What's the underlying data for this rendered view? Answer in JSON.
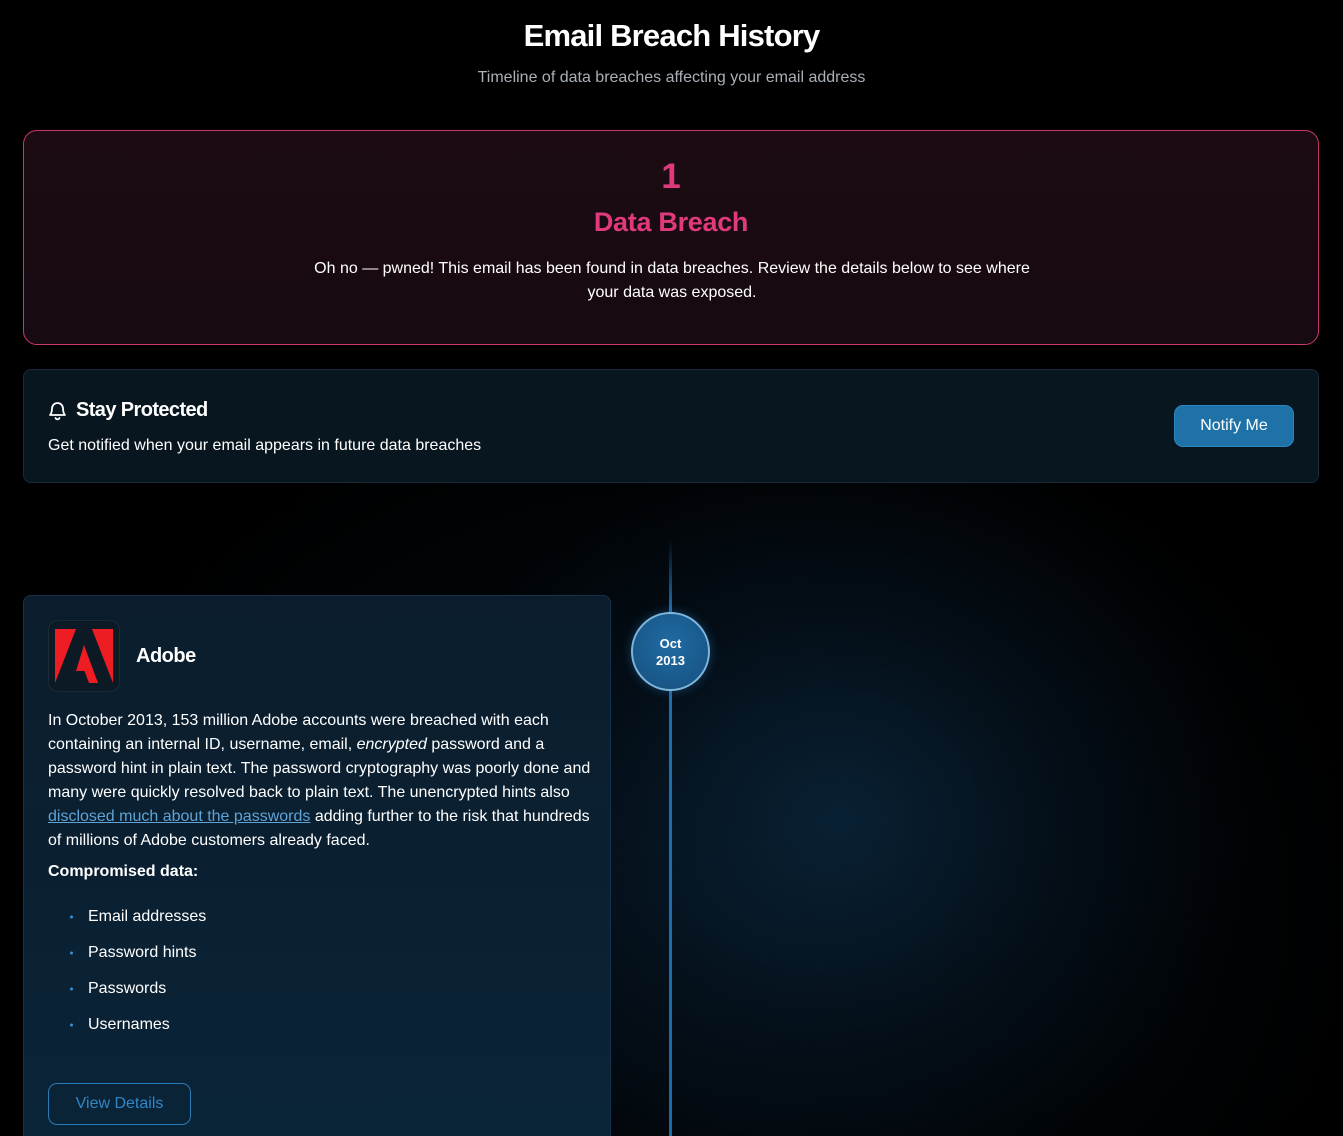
{
  "header": {
    "title": "Email Breach History",
    "subtitle": "Timeline of data breaches affecting your email address"
  },
  "summary": {
    "count": "1",
    "label": "Data Breach",
    "message": "Oh no — pwned! This email has been found in data breaches. Review the details below to see where your data was exposed.",
    "accent_color": "#e03a7c"
  },
  "notify": {
    "icon": "bell-icon",
    "title": "Stay Protected",
    "text": "Get notified when your email appears in future data breaches",
    "button_label": "Notify Me"
  },
  "timeline": {
    "entries": [
      {
        "month": "Oct",
        "year": "2013",
        "brand": "Adobe",
        "logo_icon": "adobe-logo-icon",
        "description_1": "In October 2013, 153 million Adobe accounts were breached with each containing an internal ID, username, email, ",
        "description_em": "encrypted",
        "description_2": " password and a password hint in plain text. The password cryptography was poorly done and many were quickly resolved back to plain text. The unencrypted hints also ",
        "description_link": "disclosed much about the passwords",
        "description_3": " adding further to the risk that hundreds of millions of Adobe customers already faced.",
        "compromised_heading": "Compromised data:",
        "compromised": [
          "Email addresses",
          "Password hints",
          "Passwords",
          "Usernames"
        ],
        "button_label": "View Details"
      }
    ]
  }
}
